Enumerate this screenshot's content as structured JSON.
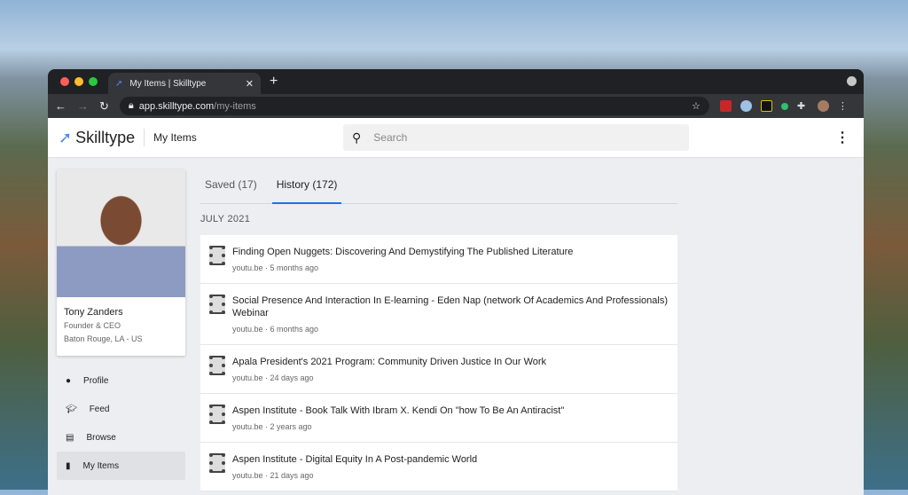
{
  "browser": {
    "tab_title": "My Items | Skilltype",
    "url_host": "app.skilltype.com",
    "url_path": "/my-items"
  },
  "header": {
    "brand": "Skilltype",
    "page_title": "My Items",
    "search_placeholder": "Search"
  },
  "profile": {
    "name": "Tony Zanders",
    "role": "Founder & CEO",
    "location": "Baton Rouge, LA - US"
  },
  "nav": [
    {
      "label": "Profile",
      "icon": "person-icon"
    },
    {
      "label": "Feed",
      "icon": "graduation-cap-icon"
    },
    {
      "label": "Browse",
      "icon": "browse-icon"
    },
    {
      "label": "My Items",
      "icon": "bookmark-icon"
    }
  ],
  "tabs": [
    {
      "label": "Saved (17)"
    },
    {
      "label": "History (172)"
    }
  ],
  "month": "JULY 2021",
  "items": [
    {
      "title": "Finding Open Nuggets: Discovering And Demystifying The Published Literature",
      "meta": "youtu.be · 5 months ago"
    },
    {
      "title": "Social Presence And Interaction In E-learning - Eden Nap (network Of Academics And Professionals) Webinar",
      "meta": "youtu.be · 6 months ago"
    },
    {
      "title": "Apala President's 2021 Program: Community Driven Justice In Our Work",
      "meta": "youtu.be · 24 days ago"
    },
    {
      "title": "Aspen Institute - Book Talk With Ibram X. Kendi On \"how To Be An Antiracist\"",
      "meta": "youtu.be · 2 years ago"
    },
    {
      "title": "Aspen Institute - Digital Equity In A Post-pandemic World",
      "meta": "youtu.be · 21 days ago"
    }
  ]
}
